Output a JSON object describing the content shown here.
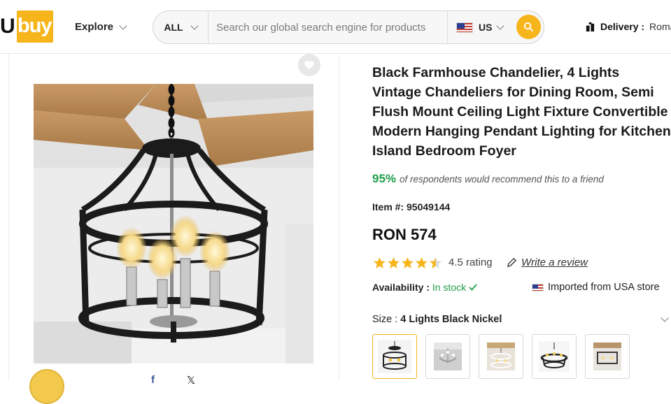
{
  "brand": {
    "logo_u": "U",
    "logo_rest": "buy"
  },
  "nav": {
    "explore_label": "Explore"
  },
  "search": {
    "category": "ALL",
    "placeholder": "Search our global search engine for products",
    "country": "US"
  },
  "delivery": {
    "label": "Delivery :",
    "value": "Romania"
  },
  "product": {
    "title": "Black Farmhouse Chandelier, 4 Lights Vintage Chandeliers for Dining Room, Semi Flush Mount Ceiling Light Fixture Convertible Modern Hanging Pendant Lighting for Kitchen Island Bedroom Foyer",
    "recommend_pct": "95%",
    "recommend_text": "of respondents would recommend this to a friend",
    "item_label": "Item #:",
    "item_number": "95049144",
    "price": "RON 574",
    "rating_value": 4.5,
    "rating_text": "4.5 rating",
    "write_review": "Write a review",
    "availability_label": "Availability :",
    "availability_value": "In stock",
    "imported_text": "Imported from USA store",
    "size_label": "Size :",
    "size_value": "4 Lights Black Nickel",
    "variants": [
      "4-lights-black-nickel",
      "crystal-candle-chandelier",
      "white-farmhouse-chandelier",
      "black-wagon-wheel-chandelier",
      "rectangular-farmhouse-chandelier"
    ]
  },
  "share": {
    "facebook": "f",
    "x": "𝕏"
  },
  "colors": {
    "accent": "#f7b51c",
    "success": "#1e9e4a",
    "star": "#f7b51c"
  }
}
